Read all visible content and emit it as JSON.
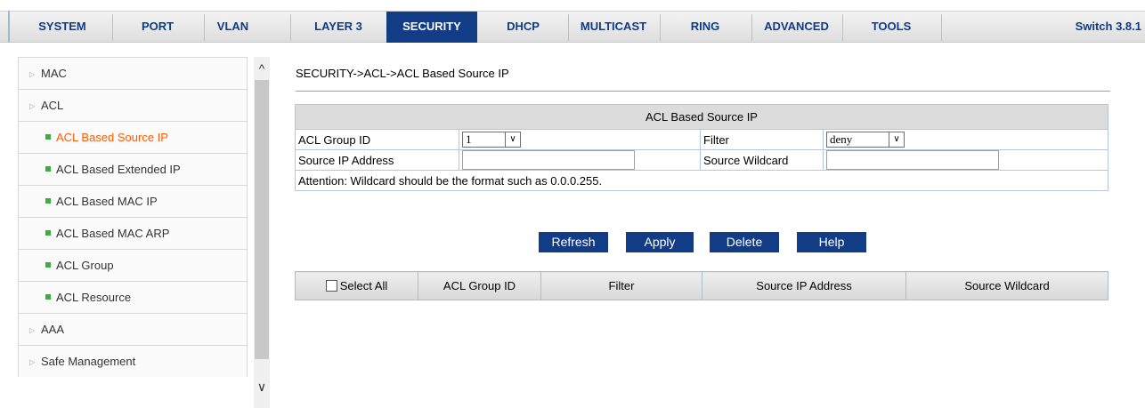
{
  "nav": {
    "tabs": [
      "SYSTEM",
      "PORT",
      "VLAN",
      "LAYER 3",
      "SECURITY",
      "DHCP",
      "MULTICAST",
      "RING",
      "ADVANCED",
      "TOOLS"
    ],
    "active_tab": "SECURITY",
    "version": "Switch 3.8.1"
  },
  "sidebar": {
    "items": [
      {
        "label": "MAC"
      },
      {
        "label": "ACL"
      },
      {
        "label": "ACL Based Source IP"
      },
      {
        "label": "ACL Based Extended IP"
      },
      {
        "label": "ACL Based MAC IP"
      },
      {
        "label": "ACL Based MAC ARP"
      },
      {
        "label": "ACL Group"
      },
      {
        "label": "ACL Resource"
      },
      {
        "label": "AAA"
      },
      {
        "label": "Safe Management"
      }
    ],
    "scroll_up": "^",
    "scroll_down": "v"
  },
  "main": {
    "breadcrumb": "SECURITY->ACL->ACL Based Source IP",
    "form": {
      "title": "ACL Based Source IP",
      "group_id_label": "ACL Group ID",
      "group_id_value": "1",
      "filter_label": "Filter",
      "filter_value": "deny",
      "source_ip_label": "Source IP Address",
      "source_ip_value": "",
      "wildcard_label": "Source Wildcard",
      "wildcard_value": "",
      "attention": "Attention: Wildcard should be the format such as 0.0.0.255."
    },
    "buttons": {
      "refresh": "Refresh",
      "apply": "Apply",
      "delete": "Delete",
      "help": "Help"
    },
    "table": {
      "select_all": "Select All",
      "columns": [
        "ACL Group ID",
        "Filter",
        "Source IP Address",
        "Source Wildcard"
      ]
    }
  }
}
